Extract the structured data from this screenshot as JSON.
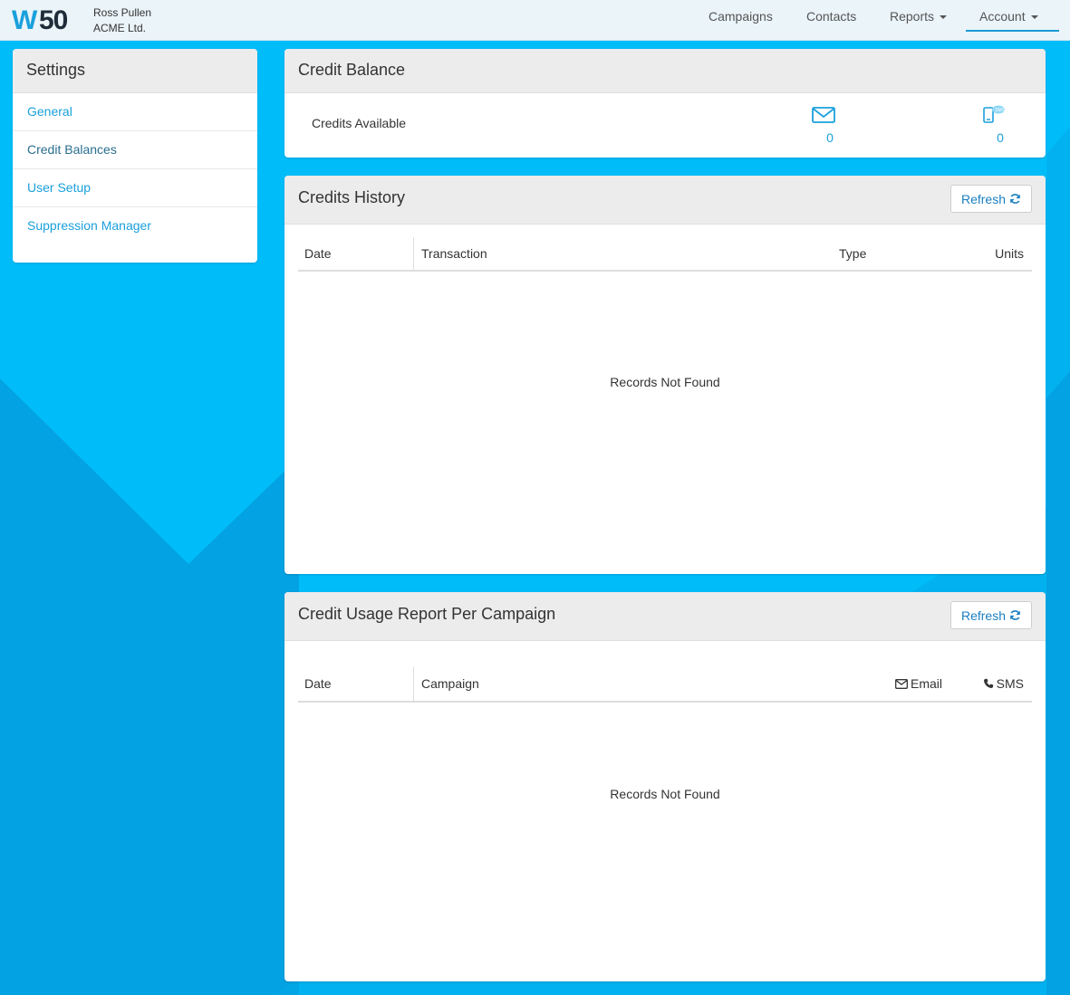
{
  "header": {
    "brand": "W50",
    "user_name": "Ross Pullen",
    "company": "ACME Ltd.",
    "nav": {
      "campaigns": "Campaigns",
      "contacts": "Contacts",
      "reports": "Reports",
      "account": "Account"
    }
  },
  "sidebar": {
    "title": "Settings",
    "items": [
      {
        "label": "General"
      },
      {
        "label": "Credit Balances",
        "active": true
      },
      {
        "label": "User Setup"
      },
      {
        "label": "Suppression Manager"
      }
    ]
  },
  "credit_balance": {
    "title": "Credit Balance",
    "label": "Credits Available",
    "email_icon": "envelope-icon",
    "email_credits": "0",
    "sms_icon": "mobile-sms-icon",
    "sms_credits": "0"
  },
  "credits_history": {
    "title": "Credits History",
    "refresh_label": "Refresh",
    "columns": {
      "date": "Date",
      "transaction": "Transaction",
      "type": "Type",
      "units": "Units"
    },
    "rows": [],
    "empty_message": "Records Not Found"
  },
  "credit_usage": {
    "title": "Credit Usage Report Per Campaign",
    "refresh_label": "Refresh",
    "columns": {
      "date": "Date",
      "campaign": "Campaign",
      "email": "Email",
      "sms": "SMS"
    },
    "rows": [],
    "empty_message": "Records Not Found"
  },
  "colors": {
    "background": "#00bdfa",
    "background_dark": "#03a2e2",
    "accent": "#1aa0dc",
    "navbar": "#eaf4f9"
  }
}
